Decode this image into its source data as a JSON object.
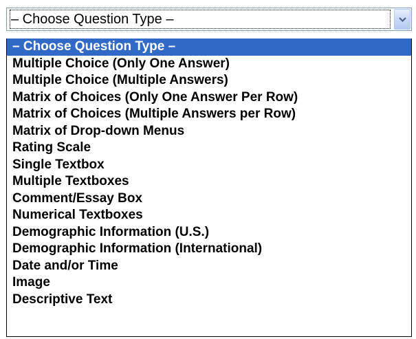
{
  "select": {
    "current_value": "– Choose Question Type –",
    "icon": "chevron-down-icon",
    "options": [
      "– Choose Question Type –",
      "Multiple Choice (Only One Answer)",
      "Multiple Choice (Multiple Answers)",
      "Matrix of Choices (Only One Answer Per Row)",
      "Matrix of Choices (Multiple Answers per Row)",
      "Matrix of Drop-down Menus",
      "Rating Scale",
      "Single Textbox",
      "Multiple Textboxes",
      "Comment/Essay Box",
      "Numerical Textboxes",
      "Demographic Information (U.S.)",
      "Demographic Information (International)",
      "Date and/or Time",
      "Image",
      "Descriptive Text"
    ],
    "highlighted_index": 0
  },
  "colors": {
    "highlight": "#3169c6",
    "button": "#c5d6f8",
    "border": "#7f9db9"
  }
}
